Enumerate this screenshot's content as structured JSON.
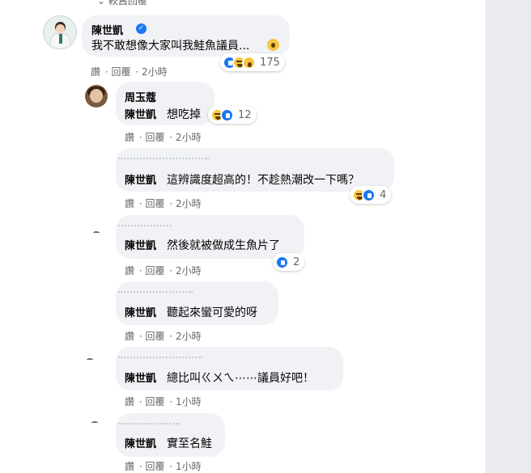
{
  "prev_replies": "⌄ 較舊回覆",
  "verified_mark": "✓",
  "comments": [
    {
      "name": "陳世凱",
      "text": "我不敢想像大家叫我鮭魚議員...",
      "actions": [
        "讚",
        "回覆",
        "2小時"
      ],
      "reactions": [
        "like",
        "haha",
        "wow"
      ],
      "count": "175"
    },
    {
      "author": "周玉蔻",
      "name": "陳世凱",
      "text": "想吃掉",
      "actions": [
        "讚",
        "回覆",
        "2小時"
      ],
      "reactions": [
        "haha",
        "like"
      ],
      "count": "12"
    },
    {
      "name": "陳世凱",
      "text": "這辨識度超高的！不趁熱潮改一下嗎？",
      "actions": [
        "讚",
        "回覆",
        "2小時"
      ],
      "reactions": [
        "haha",
        "like"
      ],
      "count": "4"
    },
    {
      "name": "陳世凱",
      "text": "然後就被做成生魚片了",
      "actions": [
        "讚",
        "回覆",
        "2小時"
      ],
      "reactions": [
        "like"
      ],
      "count": "2"
    },
    {
      "name": "陳世凱",
      "text": "聽起來蠻可愛的呀",
      "actions": [
        "讚",
        "回覆",
        "2小時"
      ],
      "reactions": [],
      "count": ""
    },
    {
      "name": "陳世凱",
      "text": "總比叫ㄍㄨㄟ⋯⋯議員好吧！",
      "actions": [
        "讚",
        "回覆",
        "1小時"
      ],
      "reactions": [],
      "count": ""
    },
    {
      "name": "陳世凱",
      "text": "實至名鮭",
      "actions": [
        "讚",
        "回覆",
        "1小時"
      ],
      "reactions": [],
      "count": ""
    }
  ],
  "colors": {
    "bubble": "#f0f2f5",
    "link_gray": "#65676b",
    "fb_blue": "#1877f2",
    "haha_yellow": "#f7c642"
  },
  "icons": [
    "verified-badge-icon",
    "like-reaction-icon",
    "haha-reaction-icon",
    "wow-reaction-icon"
  ]
}
